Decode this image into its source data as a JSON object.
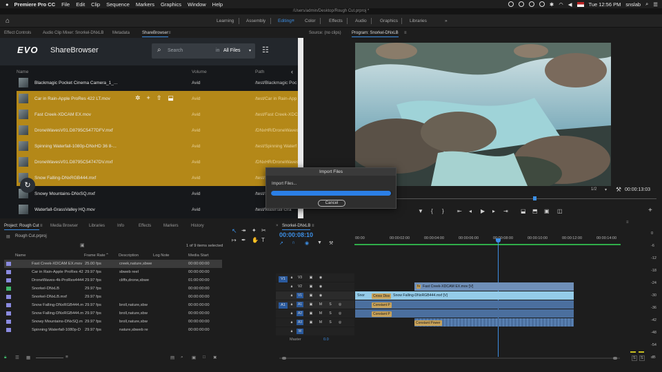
{
  "menubar": {
    "apple": "",
    "app": "Premiere Pro CC",
    "items": [
      "File",
      "Edit",
      "Clip",
      "Sequence",
      "Markers",
      "Graphics",
      "Window",
      "Help"
    ],
    "clock": "Tue 12:56 PM",
    "user": "snslab"
  },
  "path": "/Users/admin/Desktop/Rough Cut.prproj *",
  "workspaces": [
    "Learning",
    "Assembly",
    "Editing",
    "Color",
    "Effects",
    "Audio",
    "Graphics",
    "Libraries"
  ],
  "active_workspace": "Editing",
  "more": "»",
  "source_tabs": [
    "Effect Controls",
    "Audio Clip Mixer: Snorkel-DNxLB",
    "Metadata",
    "ShareBrowser"
  ],
  "sharebrowser": {
    "logo": "EVO",
    "title": "ShareBrowser",
    "search_placeholder": "Search",
    "in_label": "in",
    "scope": "All Files",
    "col_name": "Name",
    "col_volume": "Volume",
    "col_path": "Path",
    "rows": [
      {
        "name": "Blackmagic Pocket Cinema Camera_1_...",
        "volume": "Avid",
        "path": "/test/Blackmagic Poc",
        "sel": false
      },
      {
        "name": "Car in Rain-Apple ProRes 422 LT.mov",
        "volume": "Avid",
        "path": "/test/Car in Rain-App",
        "sel": true
      },
      {
        "name": "Fast Creek-XDCAM EX.mov",
        "volume": "Avid",
        "path": "/test/Fast Creek-XDC",
        "sel": true
      },
      {
        "name": "DroneWavesV01.D8795C5477DFV.mxf",
        "volume": "Avid",
        "path": "/DNxHR/DroneWaves",
        "sel": true
      },
      {
        "name": "Spinning Waterfall-1080p-DNxHD 36 8-...",
        "volume": "Avid",
        "path": "/test/Spinning Waterf",
        "sel": true
      },
      {
        "name": "DroneWavesV01.D8795C54747DV.mxf",
        "volume": "Avid",
        "path": "/DNxHR/DroneWaves",
        "sel": true
      },
      {
        "name": "Snow Falling-DNxRGB444.mxf",
        "volume": "Avid",
        "path": "/test/Snow Falling-D",
        "sel": true
      },
      {
        "name": "Snowy Mountains-DNxSQ.mxf",
        "volume": "Avid",
        "path": "/test/Snowy Mountains",
        "sel": false
      },
      {
        "name": "Waterfall-GrassValley HQ.mov",
        "volume": "Avid",
        "path": "/test/Waterfall-Gra",
        "sel": false
      }
    ]
  },
  "monitor": {
    "source_tab": "Source: (no clips)",
    "program_tab": "Program: Snorkel-DNxLB",
    "fraction": "1/2",
    "timecode": "00:00:13:03"
  },
  "dialog": {
    "title": "Import Files",
    "label": "Import Files...",
    "progress": 0.99,
    "cancel": "Cancel"
  },
  "project": {
    "tabs": [
      "Project: Rough Cut",
      "Media Browser",
      "Libraries",
      "Info",
      "Effects",
      "Markers",
      "History"
    ],
    "file": "Rough Cut.prproj",
    "count": "1 of 9 items selected",
    "cols": [
      "Name",
      "Frame Rate",
      "Description",
      "Log Note",
      "Media Start"
    ],
    "items": [
      {
        "name": "Fast Creek-XDCAM EX.mov",
        "fps": "25.00 fps",
        "desc": "creek,nature,sbwe",
        "start": "00:00:00:00",
        "color": "#8a8ae0",
        "sel": true
      },
      {
        "name": "Car in Rain-Apple ProRes 42",
        "fps": "29.97 fps",
        "desc": "sbweb reel",
        "start": "00:00:00:00",
        "color": "#8a8ae0",
        "sel": false
      },
      {
        "name": "DroneWaves-4k-ProRes4444",
        "fps": "29.97 fps",
        "desc": "cliffs,drone,sbwe",
        "start": "01:00:00:00",
        "color": "#8a8ae0",
        "sel": false
      },
      {
        "name": "Snorkel-DNxLB",
        "fps": "29.97 fps",
        "desc": "",
        "start": "00:00:00:00",
        "color": "#3fb86b",
        "sel": false
      },
      {
        "name": "Snorkel-DNxLB.mxf",
        "fps": "29.97 fps",
        "desc": "",
        "start": "00:00:00:00",
        "color": "#8a8ae0",
        "sel": false
      },
      {
        "name": "Snow Falling-DNxRGB444.m",
        "fps": "29.97 fps",
        "desc": "broll,nature,sbw",
        "start": "00:00:00:00",
        "color": "#8a8ae0",
        "sel": false
      },
      {
        "name": "Snow Falling-DNxRGB444.m",
        "fps": "29.97 fps",
        "desc": "broll,nature,sbw",
        "start": "00:00:00:00",
        "color": "#8a8ae0",
        "sel": false
      },
      {
        "name": "Snowy Mountains-DNxSQ.m",
        "fps": "29.97 fps",
        "desc": "broll,nature,sbw",
        "start": "00:00:00:00",
        "color": "#8a8ae0",
        "sel": false
      },
      {
        "name": "Spinning Waterfall-1080p-D",
        "fps": "29.97 fps",
        "desc": "nature,sbweb re",
        "start": "00:00:00:00",
        "color": "#8a8ae0",
        "sel": false
      }
    ]
  },
  "timeline": {
    "tab": "Snorkel-DNxLB",
    "timecode": "00:00:08:10",
    "ruler": [
      "00:00",
      "00:00:02:00",
      "00:00:04:00",
      "00:00:06:00",
      "00:00:08:00",
      "00:00:10:00",
      "00:00:12:00",
      "00:00:14:00"
    ],
    "tracks": [
      "V3",
      "V2",
      "V1",
      "A1",
      "A2",
      "A3",
      "M"
    ],
    "master": "Master",
    "master_val": "0.0",
    "src_v": "V1",
    "src_a": "A1",
    "clips": {
      "v2": "Fast Creek-XDCAM EX.mov [V]",
      "v1a": "Snor",
      "v1b": "Snow Falling-DNxRGB444.mxf [V]",
      "cross": "Cross Diss",
      "cp1": "Constant P",
      "cp2": "Constant P",
      "cp3": "Constant Power",
      "fx": "fx"
    }
  },
  "meters": {
    "ticks": [
      "0",
      "-6",
      "-12",
      "-18",
      "-24",
      "-30",
      "-36",
      "-42",
      "-48",
      "-54"
    ],
    "s1": "S",
    "s2": "S",
    "db": "dB"
  }
}
